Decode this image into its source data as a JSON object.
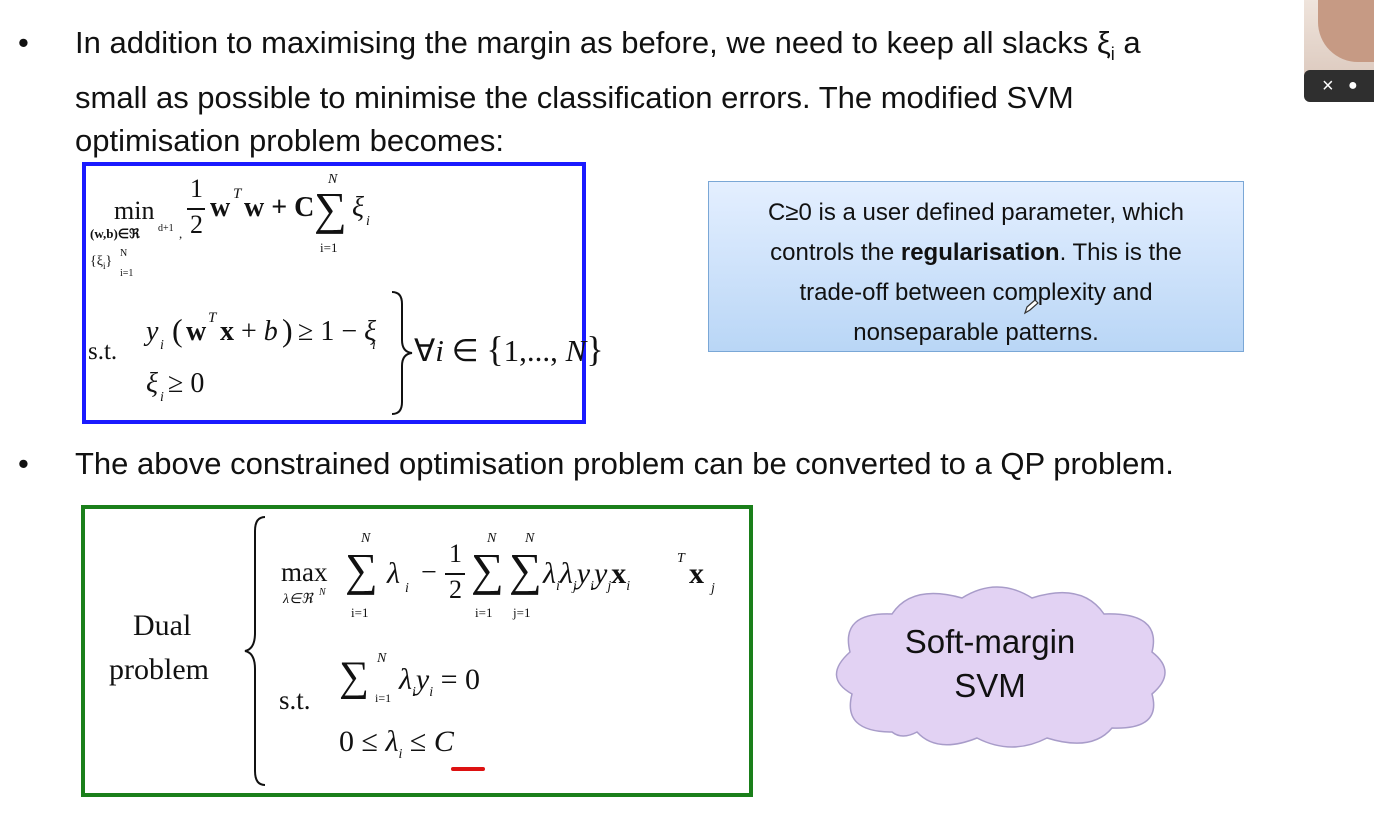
{
  "bullets": [
    {
      "symbol": "•",
      "lines": [
        "In addition to maximising the margin as before, we need to keep all slacks ξ",
        "small as possible to minimise the classification errors. The modified SVM",
        "optimisation problem becomes:"
      ],
      "sub": "i",
      "tail": " a"
    },
    {
      "symbol": "•",
      "text": "The above constrained optimisation problem can be converted to a QP problem."
    }
  ],
  "primal": {
    "min": "min",
    "min_sub1": "(w,b)∈ℜ",
    "min_sup1": "d+1",
    "min_sub2": "{ξ",
    "min_sub2_i": "i",
    "min_sub2_end": "}",
    "min_sub2_top": "N",
    "min_sub2_bot": "i=1",
    "frac_num": "1",
    "frac_den": "2",
    "obj": "w",
    "obj_sup": "T",
    "obj_w": "w + C",
    "sum_top": "N",
    "sum_bot": "i=1",
    "xi": "ξ",
    "xi_sub": "i",
    "st": "s.t.",
    "c1": "y",
    "c1_sub": "i",
    "c1_rest": "(w",
    "c1_T": "T",
    "c1_end": "x + b) ≥ 1 − ξ",
    "c1_end_sub": "i",
    "c2": "ξ",
    "c2_sub": "i",
    "c2_rest": " ≥ 0",
    "forall": "∀i ∈ {1,..., N}"
  },
  "note": {
    "line1": "C≥0 is a user defined parameter, which",
    "line2_pre": "controls the ",
    "line2_bold": "regularisation",
    "line2_post": ". This is the",
    "line3": "trade-off between complexity and",
    "line4": "nonseparable patterns."
  },
  "dual": {
    "label1": "Dual",
    "label2": "problem",
    "max": "max",
    "max_sub": "λ∈ℜ",
    "max_sup": "N",
    "sum_top": "N",
    "sum_bot": "i=1",
    "lam": "λ",
    "lam_sub": "i",
    "minus_half": "− ",
    "half_num": "1",
    "half_den": "2",
    "sum2_bot": "j=1",
    "quad": "λ",
    "quad_rest": "λ y y x",
    "x_sup": "T",
    "x_j": "x",
    "i": "i",
    "j": "j",
    "st": "s.t.",
    "c1_sum_top": "N",
    "c1_sum_bot": "i=1",
    "c1": "λ y",
    "c1_end": " = 0",
    "c2": "0 ≤ λ",
    "c2_end": " ≤ C"
  },
  "cloud": {
    "line1": "Soft-margin",
    "line2": "SVM"
  },
  "video": {
    "close": "×",
    "dot": "●"
  },
  "colors": {
    "blue_box": "#1a1aff",
    "green_box": "#1a7f1a",
    "cloud_fill": "#e2d2f3",
    "underline": "#dd1111"
  }
}
